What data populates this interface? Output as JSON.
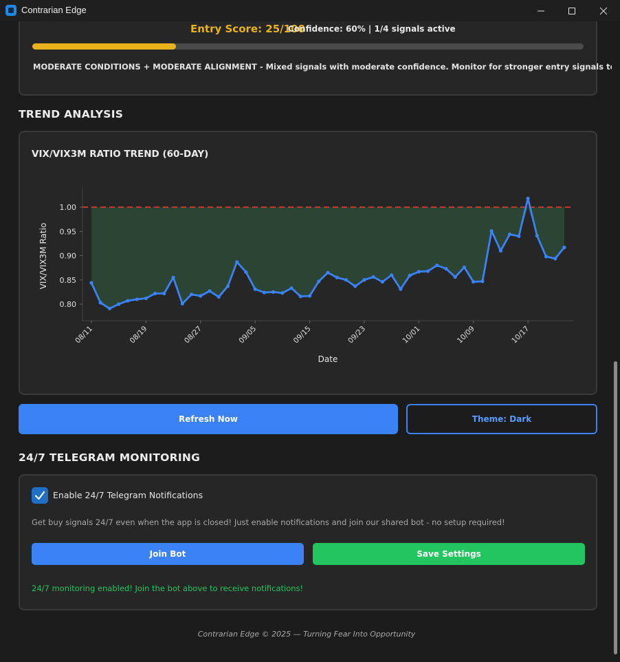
{
  "window": {
    "title": "Contrarian Edge"
  },
  "score": {
    "entry_score": "Entry Score: 25/100",
    "confidence": "Confidence: 60% | 1/4 signals active",
    "progress": 0.26,
    "conditions": "MODERATE CONDITIONS + MODERATE ALIGNMENT - Mixed signals with moderate confidence. Monitor for stronger entry signals to develop."
  },
  "trend_section": {
    "title": "TREND ANALYSIS"
  },
  "chart_data": {
    "type": "line",
    "title": "VIX/VIX3M RATIO TREND (60-DAY)",
    "xlabel": "Date",
    "ylabel": "VIX/VIX3M Ratio",
    "x_tick_labels": [
      "08/11",
      "08/19",
      "08/27",
      "09/05",
      "09/15",
      "09/23",
      "10/01",
      "10/09",
      "10/17"
    ],
    "y_tick_labels": [
      "0.80",
      "0.85",
      "0.90",
      "0.95",
      "1.00"
    ],
    "ylim": [
      0.77,
      1.05
    ],
    "threshold": 1.0,
    "colors": {
      "line": "#3b82f6",
      "threshold": "#c0392b",
      "fill": "#2d4a36"
    },
    "grid": false,
    "series": [
      {
        "values": [
          0.844,
          0.803,
          0.791,
          0.8,
          0.807,
          0.81,
          0.812,
          0.822,
          0.822,
          0.855,
          0.801,
          0.82,
          0.817,
          0.827,
          0.815,
          0.837,
          0.887,
          0.866,
          0.831,
          0.824,
          0.825,
          0.823,
          0.833,
          0.816,
          0.817,
          0.847,
          0.865,
          0.855,
          0.85,
          0.837,
          0.85,
          0.856,
          0.846,
          0.86,
          0.831,
          0.859,
          0.867,
          0.868,
          0.88,
          0.873,
          0.856,
          0.876,
          0.846,
          0.847,
          0.951,
          0.91,
          0.944,
          0.94,
          1.018,
          0.941,
          0.898,
          0.894,
          0.917
        ]
      }
    ]
  },
  "actions": {
    "refresh_label": "Refresh Now",
    "theme_label": "Theme: Dark"
  },
  "telegram": {
    "title": "24/7 TELEGRAM MONITORING",
    "enable_label": "Enable 24/7 Telegram Notifications",
    "enabled": true,
    "description": "Get buy signals 24/7 even when the app is closed! Just enable notifications and join our shared bot - no setup required!",
    "join_label": "Join Bot",
    "save_label": "Save Settings",
    "status": "24/7 monitoring enabled! Join the bot above to receive notifications!"
  },
  "footer": {
    "text": "Contrarian Edge © 2025 — Turning Fear Into Opportunity"
  }
}
